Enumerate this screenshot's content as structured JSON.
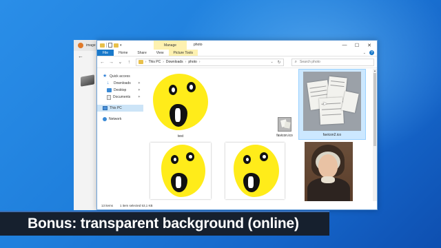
{
  "background_browser": {
    "tab_label": "image",
    "back_glyph": "←"
  },
  "explorer": {
    "title": "photo",
    "manage_tab": "Manage",
    "ribbon_tabs": [
      "File",
      "Home",
      "Share",
      "View",
      "Picture Tools"
    ],
    "window_controls": [
      "—",
      "☐",
      "✕"
    ],
    "address_crumbs": [
      "This PC",
      "Downloads",
      "photo"
    ],
    "search_placeholder": "Search photo",
    "nav_items": [
      {
        "label": "Quick access",
        "icon": "star-icon"
      },
      {
        "label": "Downloads",
        "icon": "download-icon",
        "pinned": true
      },
      {
        "label": "Desktop",
        "icon": "desktop-icon",
        "pinned": true
      },
      {
        "label": "Documents",
        "icon": "documents-icon",
        "pinned": true
      },
      {
        "label": "This PC",
        "icon": "pc-icon",
        "selected": true
      },
      {
        "label": "Network",
        "icon": "network-icon"
      }
    ],
    "files": [
      {
        "name": "test",
        "kind": "smiley"
      },
      {
        "name": "favicon.ico",
        "kind": "ico"
      },
      {
        "name": "favicon2.ico",
        "kind": "papers-photo",
        "selected": true
      },
      {
        "name": "",
        "kind": "smiley-framed"
      },
      {
        "name": "",
        "kind": "smiley-framed"
      },
      {
        "name": "",
        "kind": "portrait"
      }
    ],
    "status": {
      "items_count": "13 items",
      "selected_info": "1 item selected  53,1 KB"
    }
  },
  "banner": {
    "text": "Bonus: transparent background (online)"
  },
  "colors": {
    "desktop_blue": "#1f7fdc",
    "file_tab_blue": "#1979ca",
    "manage_yellow": "#fdf1b0",
    "smiley_yellow": "#ffec1a",
    "banner_bg": "#16202e"
  }
}
